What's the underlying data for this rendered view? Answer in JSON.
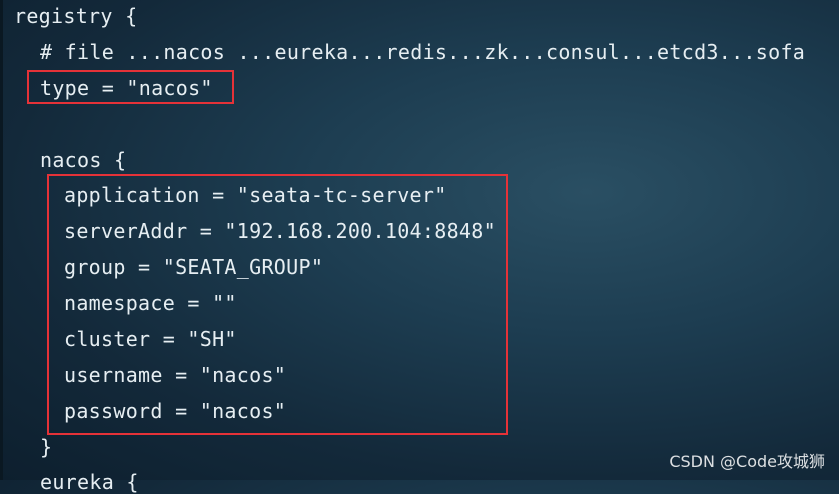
{
  "code": {
    "lines": [
      "registry {",
      "# file ...nacos ...eureka...redis...zk...consul...etcd3...sofa",
      "type = \"nacos\"",
      "nacos {",
      "application = \"seata-tc-server\"",
      "serverAddr = \"192.168.200.104:8848\"",
      "group = \"SEATA_GROUP\"",
      "namespace = \"\"",
      "cluster = \"SH\"",
      "username = \"nacos\"",
      "password = \"nacos\"",
      "}",
      "eureka {"
    ]
  },
  "watermark": "CSDN @Code攻城狮",
  "colors": {
    "highlight": "#e53238",
    "text": "#e6eef2"
  }
}
